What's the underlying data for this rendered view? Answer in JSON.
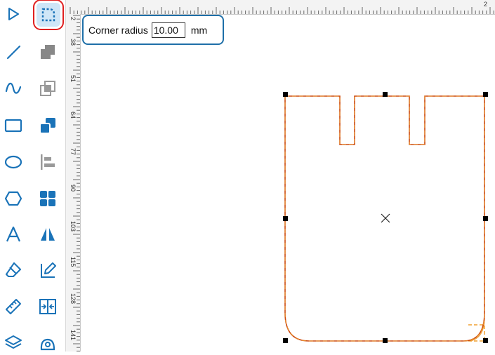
{
  "tools": [
    {
      "name": "select-tool",
      "icon": "pointer-arrow-icon"
    },
    {
      "name": "corner-radius-tool",
      "icon": "rounded-corner-icon",
      "selected": true
    },
    {
      "name": "line-tool",
      "icon": "line-icon"
    },
    {
      "name": "union-tool",
      "icon": "union-squares-icon"
    },
    {
      "name": "curve-tool",
      "icon": "curve-icon"
    },
    {
      "name": "intersect-tool",
      "icon": "intersect-squares-icon"
    },
    {
      "name": "rectangle-tool",
      "icon": "rectangle-icon"
    },
    {
      "name": "overlap-tool",
      "icon": "overlap-squares-icon"
    },
    {
      "name": "ellipse-tool",
      "icon": "ellipse-icon"
    },
    {
      "name": "align-tool",
      "icon": "align-left-icon"
    },
    {
      "name": "polygon-tool",
      "icon": "hexagon-icon"
    },
    {
      "name": "grid-arrange-tool",
      "icon": "grid-icon"
    },
    {
      "name": "text-tool",
      "icon": "letter-a-icon"
    },
    {
      "name": "mirror-tool",
      "icon": "mirror-icon"
    },
    {
      "name": "eraser-tool",
      "icon": "eraser-icon"
    },
    {
      "name": "edit-path-tool",
      "icon": "pen-edit-icon"
    },
    {
      "name": "measure-tool",
      "icon": "ruler-icon"
    },
    {
      "name": "distribute-tool",
      "icon": "distribute-icon"
    },
    {
      "name": "layers-tool",
      "icon": "layers-icon"
    },
    {
      "name": "trace-tool",
      "icon": "trace-icon"
    }
  ],
  "rulers": {
    "top_labels": [
      "2"
    ],
    "left_labels": [
      "38",
      "51",
      "64",
      "77",
      "90",
      "103",
      "115",
      "128",
      "141"
    ],
    "left_first": "2"
  },
  "corner_radius_panel": {
    "label": "Corner radius",
    "value": "10.00",
    "unit": "mm"
  },
  "colors": {
    "accent": "#1a73b8",
    "shape_outline": "#cc4a10",
    "radius_guide": "#f0a030",
    "selection_highlight": "#e02020",
    "panel_border": "#1e6fa8"
  }
}
